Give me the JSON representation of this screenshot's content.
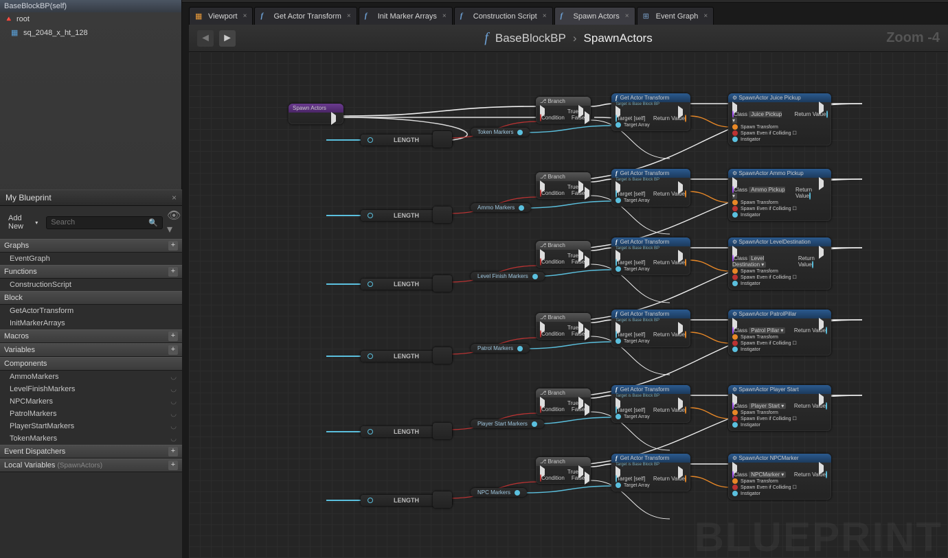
{
  "componentsPanel": {
    "header": "BaseBlockBP(self)",
    "root": "root",
    "item": "sq_2048_x_ht_128"
  },
  "tabs": [
    {
      "label": "Viewport",
      "icon": "grid",
      "closable": true
    },
    {
      "label": "Get Actor Transform",
      "icon": "fn",
      "closable": true
    },
    {
      "label": "Init Marker Arrays",
      "icon": "fn",
      "closable": true
    },
    {
      "label": "Construction Script",
      "icon": "fn",
      "closable": true
    },
    {
      "label": "Spawn Actors",
      "icon": "fn",
      "closable": true,
      "active": true
    },
    {
      "label": "Event Graph",
      "icon": "graph",
      "closable": true
    }
  ],
  "myBlueprint": {
    "title": "My Blueprint",
    "addNew": "Add New",
    "searchPlaceholder": "Search",
    "sections": {
      "graphs": {
        "label": "Graphs",
        "items": [
          "EventGraph"
        ]
      },
      "functions": {
        "label": "Functions",
        "items": [
          "ConstructionScript"
        ]
      },
      "block": {
        "label": "Block",
        "items": [
          "GetActorTransform",
          "InitMarkerArrays"
        ]
      },
      "macros": {
        "label": "Macros"
      },
      "variables": {
        "label": "Variables"
      },
      "components": {
        "label": "Components",
        "items": [
          "AmmoMarkers",
          "LevelFinishMarkers",
          "NPCMarkers",
          "PatrolMarkers",
          "PlayerStartMarkers",
          "TokenMarkers"
        ]
      },
      "dispatchers": {
        "label": "Event Dispatchers"
      },
      "local": {
        "label": "Local Variables",
        "context": "(SpawnActors)"
      }
    }
  },
  "breadcrumb": {
    "parent": "BaseBlockBP",
    "current": "SpawnActors"
  },
  "zoom": "Zoom -4",
  "watermark": "BLUEPRINT",
  "nodes": {
    "spawnActorsEntry": "Spawn Actors",
    "length": "LENGTH",
    "branch": "Branch",
    "branchPins": {
      "condition": "Condition",
      "true": "True",
      "false": "False"
    },
    "getTransform": {
      "title": "Get Actor Transform",
      "target": "Target is Base Block BP",
      "pins": {
        "target": "Target",
        "self": "self",
        "return": "Return Value",
        "array": "Target Array"
      }
    },
    "spawns": [
      {
        "title": "SpawnActor Juice Pickup",
        "class": "Juice Pickup"
      },
      {
        "title": "SpawnActor Ammo Pickup",
        "class": "Ammo Pickup"
      },
      {
        "title": "SpawnActor LevelDestination",
        "class": "Level Destination"
      },
      {
        "title": "SpawnActor PatrolPillar",
        "class": "Patrol Pillar"
      },
      {
        "title": "SpawnActor Player Start",
        "class": "Player Start"
      },
      {
        "title": "SpawnActor NPCMarker",
        "class": "NPCMarker"
      }
    ],
    "spawnPins": {
      "class": "Class",
      "transform": "Spawn Transform",
      "collide": "Spawn Even if Colliding",
      "instigator": "Instigator",
      "return": "Return Value"
    },
    "vars": [
      "Token Markers",
      "Ammo Markers",
      "Level Finish Markers",
      "Patrol Markers",
      "Player Start Markers",
      "NPC Markers"
    ]
  }
}
